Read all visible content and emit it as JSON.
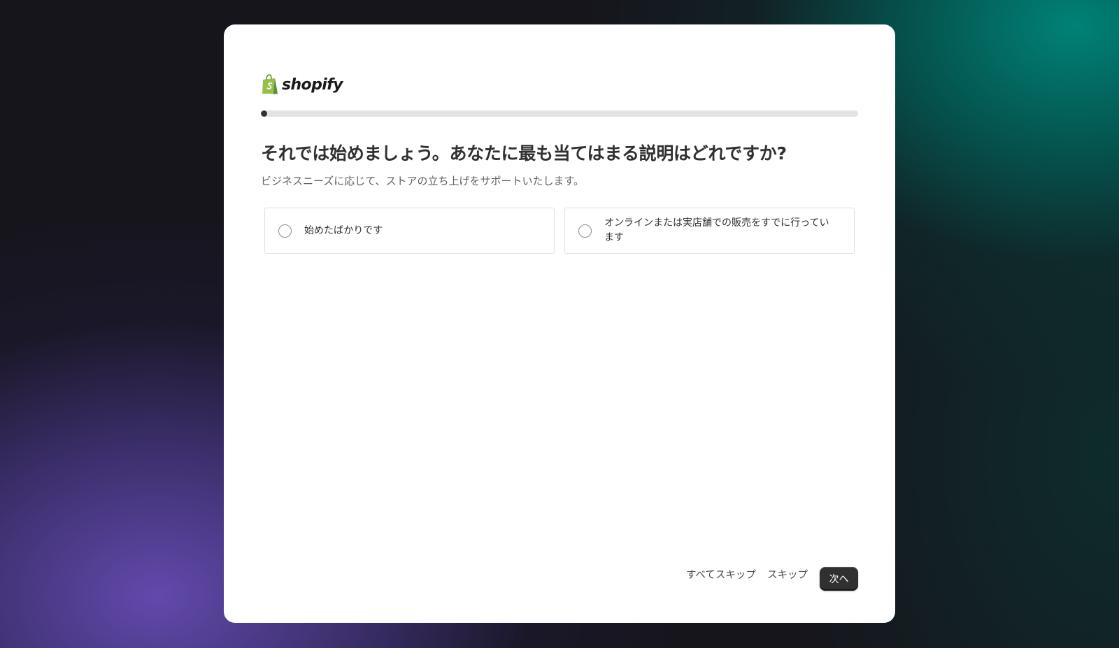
{
  "brand": {
    "name": "shopify",
    "logo_icon": "shopify-bag-icon",
    "colors": {
      "bag_light": "#95BF47",
      "bag_dark": "#5E8E3E"
    }
  },
  "progress": {
    "value_percent": 1
  },
  "question": {
    "title": "それでは始めましょう。あなたに最も当てはまる説明はどれですか?",
    "subtitle": "ビジネスニーズに応じて、ストアの立ち上げをサポートいたします。"
  },
  "options": [
    {
      "label": "始めたばかりです",
      "selected": false
    },
    {
      "label": "オンラインまたは実店舗での販売をすでに行っています",
      "selected": false
    }
  ],
  "footer": {
    "skip_all_label": "すべてスキップ",
    "skip_label": "スキップ",
    "next_label": "次へ"
  },
  "theme": {
    "primary_button": "#303030",
    "background_purple": "#5B45A0",
    "background_teal": "#00827A"
  }
}
